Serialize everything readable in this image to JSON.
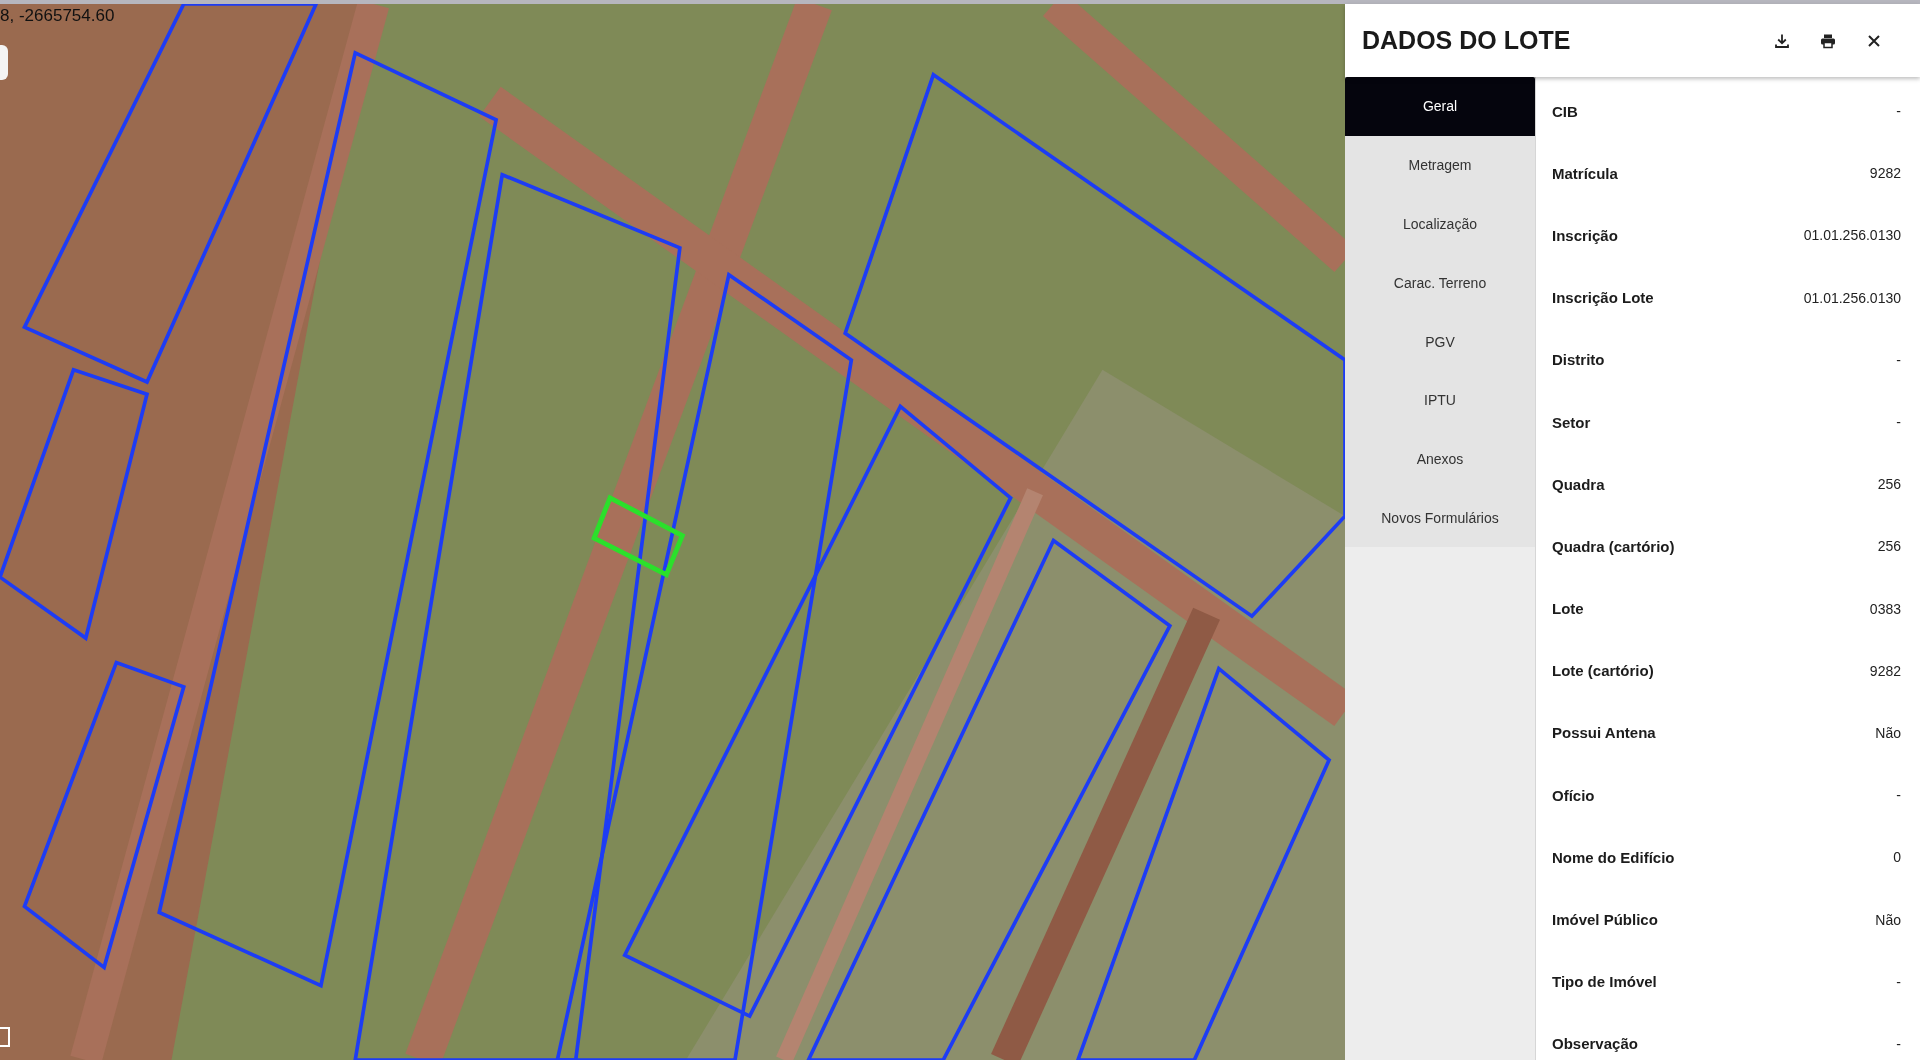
{
  "map": {
    "coordinates": "8, -2665754.60"
  },
  "panel": {
    "title": "DADOS DO LOTE",
    "tabs": [
      {
        "label": "Geral",
        "selected": true
      },
      {
        "label": "Metragem",
        "selected": false
      },
      {
        "label": "Localização",
        "selected": false
      },
      {
        "label": "Carac. Terreno",
        "selected": false
      },
      {
        "label": "PGV",
        "selected": false
      },
      {
        "label": "IPTU",
        "selected": false
      },
      {
        "label": "Anexos",
        "selected": false
      },
      {
        "label": "Novos Formulários",
        "selected": false
      }
    ],
    "fields": [
      {
        "label": "CIB",
        "value": "-"
      },
      {
        "label": "Matrícula",
        "value": "9282"
      },
      {
        "label": "Inscrição",
        "value": "01.01.256.0130"
      },
      {
        "label": "Inscrição Lote",
        "value": "01.01.256.0130"
      },
      {
        "label": "Distrito",
        "value": "-"
      },
      {
        "label": "Setor",
        "value": "-"
      },
      {
        "label": "Quadra",
        "value": "256"
      },
      {
        "label": "Quadra (cartório)",
        "value": "256"
      },
      {
        "label": "Lote",
        "value": "0383"
      },
      {
        "label": "Lote (cartório)",
        "value": "9282"
      },
      {
        "label": "Possui Antena",
        "value": "Não"
      },
      {
        "label": "Ofício",
        "value": "-"
      },
      {
        "label": "Nome do Edifício",
        "value": "0"
      },
      {
        "label": "Imóvel Público",
        "value": "Não"
      },
      {
        "label": "Tipo de Imóvel",
        "value": "-"
      },
      {
        "label": "Observação",
        "value": "-"
      }
    ]
  }
}
